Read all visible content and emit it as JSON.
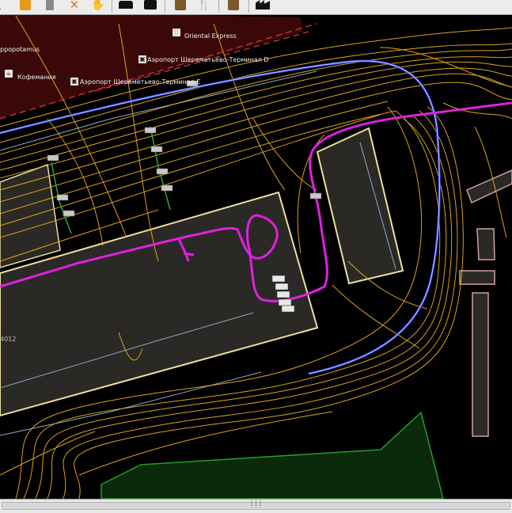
{
  "toolbar": {
    "buttons": [
      {
        "name": "hiking-icon",
        "glyph": "🚶",
        "color": "#2b6cb0"
      },
      {
        "name": "fuel-icon",
        "glyph": "⛽",
        "color": "#e49a1a"
      },
      {
        "name": "phone-icon",
        "glyph": "▮",
        "color": "#8a8a8a"
      },
      {
        "name": "tools-icon",
        "glyph": "✕",
        "color": "#d9772b"
      },
      {
        "name": "hand-icon",
        "glyph": "✋",
        "color": "#111111"
      },
      {
        "name": "car-icon",
        "glyph": "🚘",
        "color": "#111111"
      },
      {
        "name": "bus-icon",
        "glyph": "🚌",
        "color": "#111111"
      },
      {
        "name": "info-icon",
        "glyph": "ℹ",
        "color": "#7a5a2a"
      },
      {
        "name": "restaurant-icon",
        "glyph": "🍴",
        "color": "#7a5a2a"
      },
      {
        "name": "museum-icon",
        "glyph": "🏛",
        "color": "#7a5a2a"
      },
      {
        "name": "factory-icon",
        "glyph": "🏭",
        "color": "#111111"
      }
    ]
  },
  "map": {
    "labels": {
      "oriental": "Oriental Express",
      "hippopotamus": "ppopotamus",
      "terminal_d": "Аэропорт Шереметьево-Терминал D",
      "terminal_e": "Аэропорт Шереметьево-Терминал E",
      "coffee": "Кофемания",
      "number_4012": "4012"
    },
    "colors": {
      "background": "#000000",
      "terminal_zone": "#3a0808",
      "building_fill": "#2b2925",
      "building_outline": "#ece0a0",
      "taxiway_blue": "#3340d8",
      "gps_tracks": "#f5b31c",
      "route_magenta": "#e020e0",
      "green_area": "#0b2a0b",
      "green_outline": "#2a9a2a",
      "service_line": "#8ea8c8"
    }
  },
  "statusbar": {
    "grip": "⁞⁞⁞"
  }
}
